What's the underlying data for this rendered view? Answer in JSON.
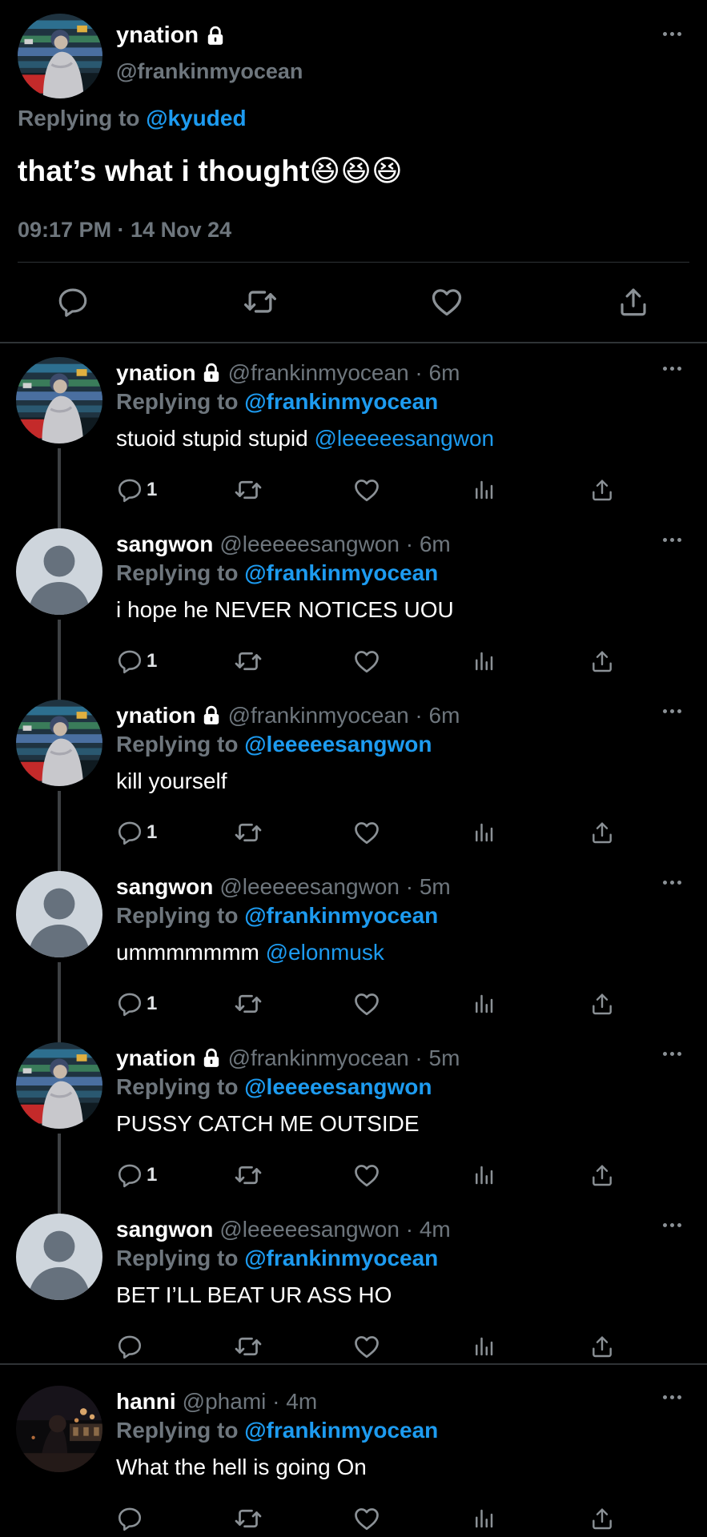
{
  "main_tweet": {
    "name": "ynation",
    "handle": "@frankinmyocean",
    "replying_prefix": "Replying to",
    "replying_to": "@kyuded",
    "text": "that’s what i thought😆😆😆",
    "timestamp": "09:17 PM · 14 Nov 24",
    "icons": [
      "reply-icon",
      "retweet-icon",
      "like-icon",
      "share-icon"
    ]
  },
  "replies": [
    {
      "name": "ynation",
      "locked": true,
      "handle_time": "@frankinmyocean · 6m",
      "replying_prefix": "Replying to",
      "replying_to": "@frankinmyocean",
      "text": "stuoid stupid stupid ",
      "mention": "@leeeeesangwon",
      "reply_count": "1",
      "avatar": "photo"
    },
    {
      "name": "sangwon",
      "locked": false,
      "handle_time": "@leeeeesangwon · 6m",
      "replying_prefix": "Replying to",
      "replying_to": "@frankinmyocean",
      "text": "i hope he NEVER NOTICES UOU",
      "mention": "",
      "reply_count": "1",
      "avatar": "default"
    },
    {
      "name": "ynation",
      "locked": true,
      "handle_time": "@frankinmyocean · 6m",
      "replying_prefix": "Replying to",
      "replying_to": "@leeeeesangwon",
      "text": "kill yourself",
      "mention": "",
      "reply_count": "1",
      "avatar": "photo"
    },
    {
      "name": "sangwon",
      "locked": false,
      "handle_time": "@leeeeesangwon · 5m",
      "replying_prefix": "Replying to",
      "replying_to": "@frankinmyocean",
      "text": "ummmmmmm ",
      "mention": "@elonmusk",
      "reply_count": "1",
      "avatar": "default"
    },
    {
      "name": "ynation",
      "locked": true,
      "handle_time": "@frankinmyocean · 5m",
      "replying_prefix": "Replying to",
      "replying_to": "@leeeeesangwon",
      "text": "PUSSY CATCH ME OUTSIDE",
      "mention": "",
      "reply_count": "1",
      "avatar": "photo"
    },
    {
      "name": "sangwon",
      "locked": false,
      "handle_time": "@leeeeesangwon · 4m",
      "replying_prefix": "Replying to",
      "replying_to": "@frankinmyocean",
      "text": "BET I’LL BEAT UR ASS HO",
      "mention": "",
      "reply_count": "",
      "avatar": "default"
    },
    {
      "name": "hanni",
      "locked": false,
      "handle_time": "@phami · 4m",
      "replying_prefix": "Replying to",
      "replying_to": "@frankinmyocean",
      "text": "What the hell is going On",
      "mention": "",
      "reply_count": "",
      "avatar": "night-photo"
    }
  ],
  "colors": {
    "background": "#000000",
    "accent": "#1d9bf0",
    "secondary_text": "#6e767d",
    "divider": "#2f3336"
  }
}
